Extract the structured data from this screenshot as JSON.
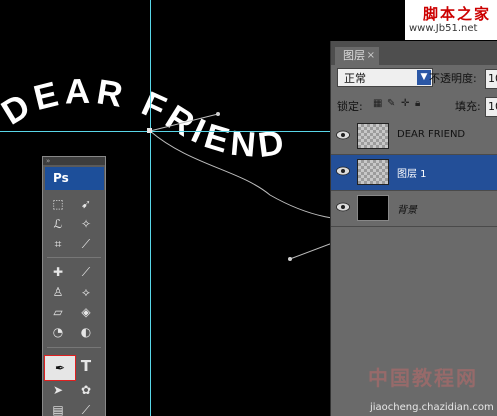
{
  "canvas": {
    "art_text": "DEAR FRIEND",
    "guides": "cyan"
  },
  "watermark_top": {
    "chinese": "脚本之家",
    "url": "www.Jb51.net"
  },
  "watermark_bottom": {
    "chinese": "中国教程网",
    "url": "jiaocheng.chazidian.com"
  },
  "toolbox": {
    "logo": "Ps",
    "selected_tool": "pen-tool",
    "type_tool_glyph": "T"
  },
  "layers_panel": {
    "tab_label": "图层",
    "tab_close": "×",
    "blend_mode": "正常",
    "opacity_label": "不透明度:",
    "opacity_value": "10",
    "lock_label": "锁定:",
    "fill_label": "填充:",
    "fill_value": "10",
    "layers": [
      {
        "name": "DEAR FRIEND",
        "thumb": "checker",
        "selected": false
      },
      {
        "name": "图层 1",
        "thumb": "checker",
        "selected": true
      },
      {
        "name": "背景",
        "thumb": "black",
        "selected": false
      }
    ]
  },
  "colors": {
    "guide": "#59d6e8",
    "selected_layer": "#234f98",
    "ps_logo_bg": "#1d4f9a",
    "selected_tool_border": "#e02020"
  }
}
